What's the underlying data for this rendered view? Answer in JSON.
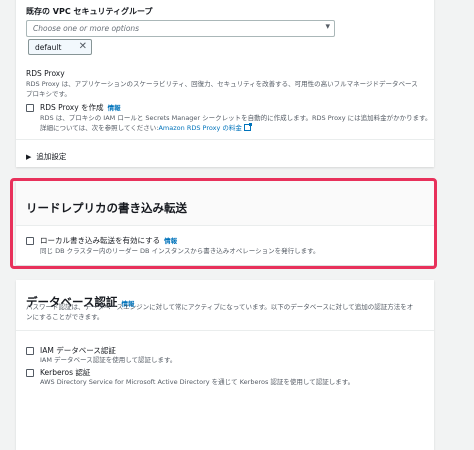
{
  "vpc_sg": {
    "label": "既存の VPC セキュリティグループ",
    "placeholder": "Choose one or more options",
    "selected_token": "default"
  },
  "rds_proxy": {
    "title": "RDS Proxy",
    "desc_line1": "RDS Proxy は、アプリケーションのスケーラビリティ、回復力、セキュリティを改善する、可用性の高いフルマネージドデータベース",
    "desc_line2": "プロキシです。",
    "checkbox_label": "RDS Proxy を作成",
    "info": "情報",
    "sub_line1": "RDS は、プロキシの IAM ロールと Secrets Manager シークレットを自動的に作成します。RDS Proxy には追加料金がかかります。",
    "sub_line2_prefix": "詳細については、次を参照してください:",
    "sub_line2_link": "Amazon RDS Proxy の料金"
  },
  "additional_settings": "追加設定",
  "replica": {
    "title": "リードレプリカの書き込み転送",
    "checkbox_label": "ローカル書き込み転送を有効にする",
    "info": "情報",
    "desc": "同じ DB クラスター内のリーダー DB インスタンスから書き込みオペレーションを発行します。"
  },
  "auth": {
    "title": "データベース認証",
    "info": "情報",
    "desc_line1": "パスワード認証は、データベースエンジンに対して常にアクティブになっています。以下のデータベースに対して追加の認証方法をオ",
    "desc_line2": "ンにすることができます。",
    "iam_label": "IAM データベース認証",
    "iam_desc": "IAM データベース認証を使用して認証します。",
    "kerberos_label": "Kerberos 認証",
    "kerberos_desc": "AWS Directory Service for Microsoft Active Directory を通じて Kerberos 認証を使用して認証します。"
  },
  "colors": {
    "highlight": "#e8315b",
    "link": "#0073bb",
    "background": "#f2f3f3"
  }
}
